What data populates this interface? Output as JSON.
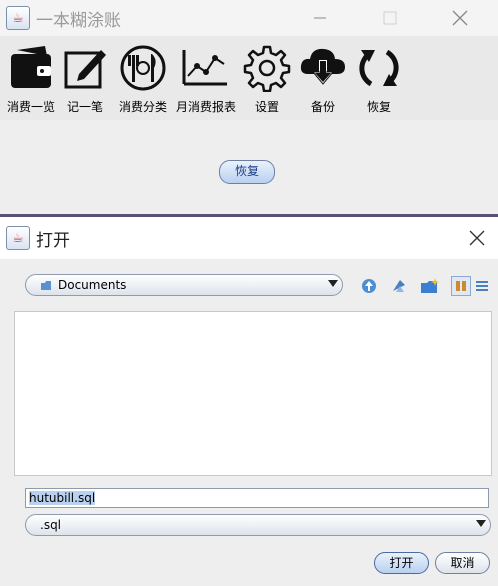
{
  "main_window": {
    "title": "一本糊涂账",
    "toolbar": [
      {
        "label": "消费一览",
        "icon": "wallet-icon"
      },
      {
        "label": "记一笔",
        "icon": "edit-icon"
      },
      {
        "label": "消费分类",
        "icon": "dining-icon"
      },
      {
        "label": "月消费报表",
        "icon": "chart-icon"
      },
      {
        "label": "设置",
        "icon": "gear-icon"
      },
      {
        "label": "备份",
        "icon": "cloud-download-icon"
      },
      {
        "label": "恢复",
        "icon": "refresh-icon"
      }
    ],
    "restore_button": "恢复"
  },
  "dialog": {
    "title": "打开",
    "look_in": "Documents",
    "file_name": "hutubill.sql",
    "file_type": ".sql",
    "open_button": "打开",
    "cancel_button": "取消"
  }
}
